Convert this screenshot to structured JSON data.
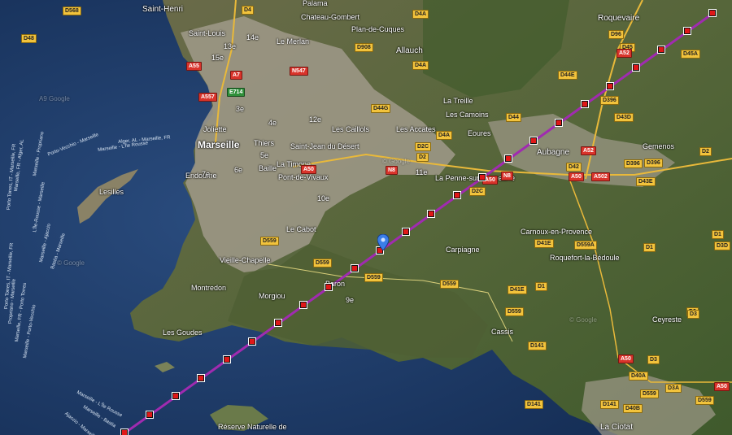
{
  "map": {
    "colors": {
      "sea": "#1b3a66",
      "land": "#5a6a3a",
      "urban": "#a8a294",
      "route": "#a02bb0",
      "waypoint": "#e01818",
      "marker": "#3a7ee8"
    },
    "icons": {
      "waypoint": "red-square-waypoint-icon",
      "marker": "blue-location-pin-icon",
      "park": "park-icon"
    },
    "places": [
      {
        "name": "Saint-Henri",
        "cls": "mid"
      },
      {
        "name": "Palama",
        "cls": ""
      },
      {
        "name": "Chateau-Gombert",
        "cls": ""
      },
      {
        "name": "Saint-Louis",
        "cls": ""
      },
      {
        "name": "Le Merlan",
        "cls": ""
      },
      {
        "name": "Plan-de-Cuques",
        "cls": ""
      },
      {
        "name": "Allauch",
        "cls": "mid"
      },
      {
        "name": "Roquevaire",
        "cls": "mid"
      },
      {
        "name": "14e",
        "cls": ""
      },
      {
        "name": "13e",
        "cls": ""
      },
      {
        "name": "15e",
        "cls": ""
      },
      {
        "name": "3e",
        "cls": ""
      },
      {
        "name": "Joliette",
        "cls": ""
      },
      {
        "name": "Marseille",
        "cls": "big"
      },
      {
        "name": "4e",
        "cls": ""
      },
      {
        "name": "12e",
        "cls": ""
      },
      {
        "name": "La Treille",
        "cls": ""
      },
      {
        "name": "Les Camoins",
        "cls": ""
      },
      {
        "name": "Les Caillols",
        "cls": ""
      },
      {
        "name": "Les Accates",
        "cls": ""
      },
      {
        "name": "Eoures",
        "cls": ""
      },
      {
        "name": "Aubagne",
        "cls": "mid"
      },
      {
        "name": "Gemenos",
        "cls": ""
      },
      {
        "name": "Thiers",
        "cls": ""
      },
      {
        "name": "Saint-Jean du Désert",
        "cls": ""
      },
      {
        "name": "5e",
        "cls": ""
      },
      {
        "name": "La Timone",
        "cls": ""
      },
      {
        "name": "Baille",
        "cls": ""
      },
      {
        "name": "6e",
        "cls": ""
      },
      {
        "name": "Endoume",
        "cls": ""
      },
      {
        "name": "7e",
        "cls": ""
      },
      {
        "name": "Pont-de-Vivaux",
        "cls": ""
      },
      {
        "name": "11e",
        "cls": ""
      },
      {
        "name": "La Penne-sur-Huveaune",
        "cls": ""
      },
      {
        "name": "10e",
        "cls": ""
      },
      {
        "name": "Le Cabot",
        "cls": ""
      },
      {
        "name": "Lesilles",
        "cls": ""
      },
      {
        "name": "Vieille-Chapelle",
        "cls": ""
      },
      {
        "name": "Carpiagne",
        "cls": ""
      },
      {
        "name": "Carnoux-en-Provence",
        "cls": ""
      },
      {
        "name": "Roquefort-la-Bédoule",
        "cls": ""
      },
      {
        "name": "Montredon",
        "cls": ""
      },
      {
        "name": "Morgiou",
        "cls": ""
      },
      {
        "name": "Baron",
        "cls": ""
      },
      {
        "name": "9e",
        "cls": ""
      },
      {
        "name": "Les Goudes",
        "cls": ""
      },
      {
        "name": "Cassis",
        "cls": ""
      },
      {
        "name": "Ceyreste",
        "cls": ""
      },
      {
        "name": "La Ciotat",
        "cls": "mid"
      },
      {
        "name": "Réserve Naturelle de",
        "cls": ""
      }
    ],
    "shields": [
      {
        "label": "D568",
        "t": "d"
      },
      {
        "label": "D48",
        "t": "d"
      },
      {
        "label": "D4",
        "t": "d"
      },
      {
        "label": "D4A",
        "t": "d"
      },
      {
        "label": "D908",
        "t": "d"
      },
      {
        "label": "A7",
        "t": "a"
      },
      {
        "label": "N547",
        "t": "a"
      },
      {
        "label": "D4A",
        "t": "d"
      },
      {
        "label": "A55",
        "t": "a"
      },
      {
        "label": "E714",
        "t": "e"
      },
      {
        "label": "A557",
        "t": "a"
      },
      {
        "label": "D44G",
        "t": "d"
      },
      {
        "label": "D44",
        "t": "d"
      },
      {
        "label": "D4A",
        "t": "d"
      },
      {
        "label": "D2C",
        "t": "d"
      },
      {
        "label": "A50",
        "t": "a"
      },
      {
        "label": "D2",
        "t": "d"
      },
      {
        "label": "N8",
        "t": "a"
      },
      {
        "label": "A50",
        "t": "a"
      },
      {
        "label": "D2C",
        "t": "d"
      },
      {
        "label": "D396",
        "t": "d"
      },
      {
        "label": "D45",
        "t": "d"
      },
      {
        "label": "A52",
        "t": "a"
      },
      {
        "label": "D45A",
        "t": "d"
      },
      {
        "label": "D96",
        "t": "d"
      },
      {
        "label": "D44E",
        "t": "d"
      },
      {
        "label": "D43D",
        "t": "d"
      },
      {
        "label": "D2",
        "t": "d"
      },
      {
        "label": "A52",
        "t": "a"
      },
      {
        "label": "D396",
        "t": "d"
      },
      {
        "label": "A50",
        "t": "a"
      },
      {
        "label": "A502",
        "t": "a"
      },
      {
        "label": "D42",
        "t": "d"
      },
      {
        "label": "D43E",
        "t": "d"
      },
      {
        "label": "N8",
        "t": "a"
      },
      {
        "label": "D559",
        "t": "d"
      },
      {
        "label": "D559",
        "t": "d"
      },
      {
        "label": "D41E",
        "t": "d"
      },
      {
        "label": "D559A",
        "t": "d"
      },
      {
        "label": "D1",
        "t": "d"
      },
      {
        "label": "D1",
        "t": "d"
      },
      {
        "label": "D3D",
        "t": "d"
      },
      {
        "label": "D559",
        "t": "d"
      },
      {
        "label": "D559",
        "t": "d"
      },
      {
        "label": "D41E",
        "t": "d"
      },
      {
        "label": "D1",
        "t": "d"
      },
      {
        "label": "D559",
        "t": "d"
      },
      {
        "label": "D3",
        "t": "d"
      },
      {
        "label": "D141",
        "t": "d"
      },
      {
        "label": "A50",
        "t": "a"
      },
      {
        "label": "D3",
        "t": "d"
      },
      {
        "label": "D40A",
        "t": "d"
      },
      {
        "label": "D3A",
        "t": "d"
      },
      {
        "label": "A50",
        "t": "a"
      },
      {
        "label": "D559",
        "t": "d"
      },
      {
        "label": "D141",
        "t": "d"
      },
      {
        "label": "D141",
        "t": "d"
      },
      {
        "label": "D40B",
        "t": "d"
      },
      {
        "label": "D559",
        "t": "d"
      },
      {
        "label": "D2",
        "t": "d"
      },
      {
        "label": "D396",
        "t": "d"
      },
      {
        "label": "D3",
        "t": "d"
      },
      {
        "label": "D1",
        "t": "d"
      }
    ],
    "ferries": [
      {
        "label": "Porto-Vecchio - Marseille"
      },
      {
        "label": "Alger, AL - Marseille, FR"
      },
      {
        "label": "Marseille - L'Île Rousse"
      },
      {
        "label": "Marseille - Propriano"
      },
      {
        "label": "Marseille, FR - Alger, AL"
      },
      {
        "label": "Porto Torres, IT - Marseille, FR"
      },
      {
        "label": "L'Île-Rousse - Marseille"
      },
      {
        "label": "Bastia - Marseille"
      },
      {
        "label": "Marseille - Ajaccio"
      },
      {
        "label": "Porto Torres, IT - Marseille, FR"
      },
      {
        "label": "Propriano - Marseille"
      },
      {
        "label": "Marseille, FR - Porto Torres"
      },
      {
        "label": "Marseille - Porto-Vecchio"
      },
      {
        "label": "Marseille - Bastia"
      },
      {
        "label": "Marseille - L'Île Rousse"
      },
      {
        "label": "Ajaccio - Marseille"
      }
    ],
    "watermarks": [
      "A9 Google",
      "© Google",
      "© Google",
      "© Google"
    ],
    "waypoint_count": 24
  }
}
